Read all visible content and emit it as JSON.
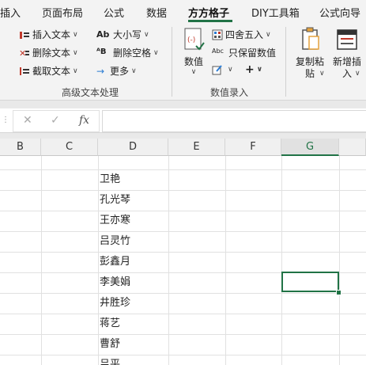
{
  "tabs": [
    "插入",
    "页面布局",
    "公式",
    "数据",
    "方方格子",
    "DIY工具箱",
    "公式向导"
  ],
  "ribbon": {
    "text_group": {
      "insert_text": "插入文本",
      "delete_text": "删除文本",
      "extract_text": "截取文本",
      "case": "大小写",
      "delete_spaces": "删除空格",
      "more": "更多",
      "label": "高级文本处理"
    },
    "number_group": {
      "values": "数值",
      "round": "四舍五入",
      "keep_values": "只保留数值",
      "plus": "+",
      "label": "数值录入"
    },
    "copy_paste": "复制粘\n贴",
    "new_insert": "新增插\n入"
  },
  "formula_bar": {
    "cancel": "✕",
    "confirm": "✓",
    "fx": "fx",
    "value": ""
  },
  "columns": [
    "B",
    "C",
    "D",
    "E",
    "F",
    "G"
  ],
  "selected_column": "G",
  "cells": [
    "卫艳",
    "孔光琴",
    "王亦寒",
    "吕灵竹",
    "彭鑫月",
    "李美娟",
    "井胜珍",
    "蒋艺",
    "曹舒",
    "吕平"
  ],
  "colors": {
    "accent": "#217346"
  }
}
